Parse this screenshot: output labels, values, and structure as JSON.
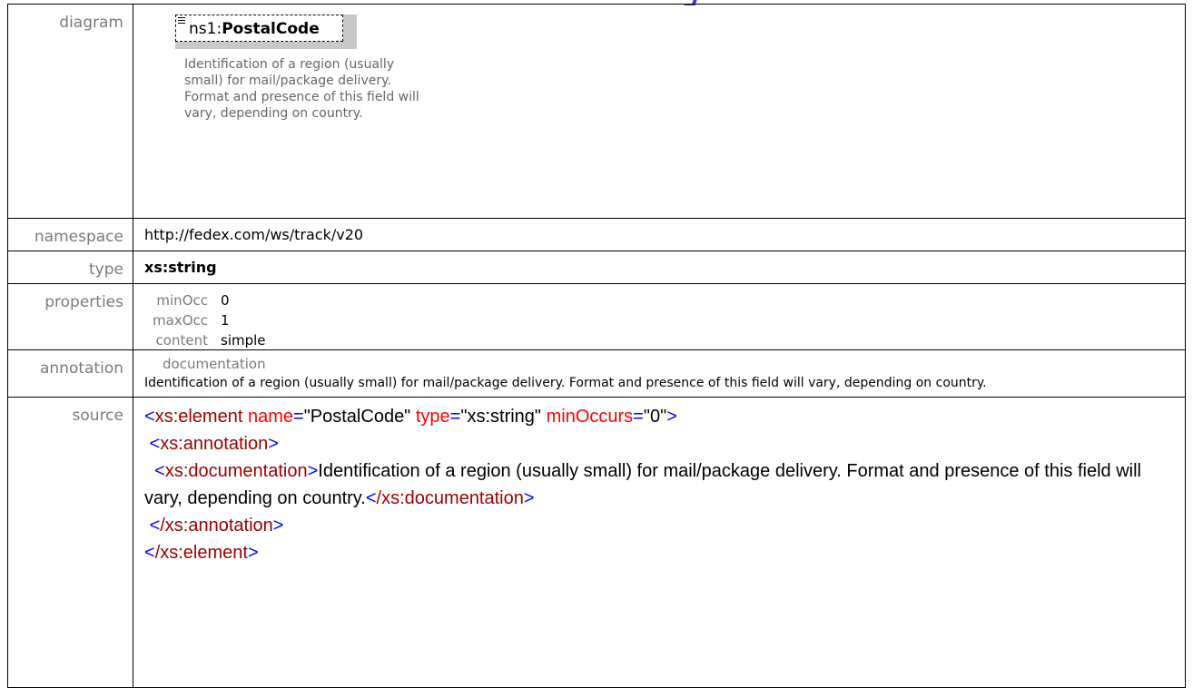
{
  "rows": {
    "diagram": {
      "label": "diagram",
      "prefix": "ns1:",
      "name": "PostalCode",
      "description": "Identification of a region (usually small) for mail/package delivery. Format and presence of this field will vary, depending on country."
    },
    "namespace": {
      "label": "namespace",
      "value": "http://fedex.com/ws/track/v20"
    },
    "type": {
      "label": "type",
      "value": "xs:string"
    },
    "properties": {
      "label": "properties",
      "items": [
        {
          "key": "minOcc",
          "value": "0"
        },
        {
          "key": "maxOcc",
          "value": "1"
        },
        {
          "key": "content",
          "value": "simple"
        }
      ]
    },
    "annotation": {
      "label": "annotation",
      "heading": "documentation",
      "text": "Identification of a region (usually small) for mail/package delivery. Format and presence of this field will vary, depending on country."
    },
    "source": {
      "label": "source",
      "el_open": "xs:element",
      "attr_name": "name",
      "attr_name_val": "\"PostalCode\"",
      "attr_type": "type",
      "attr_type_val": "\"xs:string\"",
      "attr_min": "minOccurs",
      "attr_min_val": "\"0\"",
      "anno_tag": "xs:annotation",
      "doc_tag": "xs:documentation",
      "doc_text": "Identification of a region (usually small) for mail/package delivery. Format and presence of this field will vary, depending on country.",
      "doc_close": "/xs:documentation",
      "anno_close": "/xs:annotation",
      "el_close": "/xs:element"
    }
  },
  "colors": {
    "tag": "#990000",
    "punct": "#0000ff",
    "attr": "#ff0000",
    "label": "#7a7a7a"
  }
}
